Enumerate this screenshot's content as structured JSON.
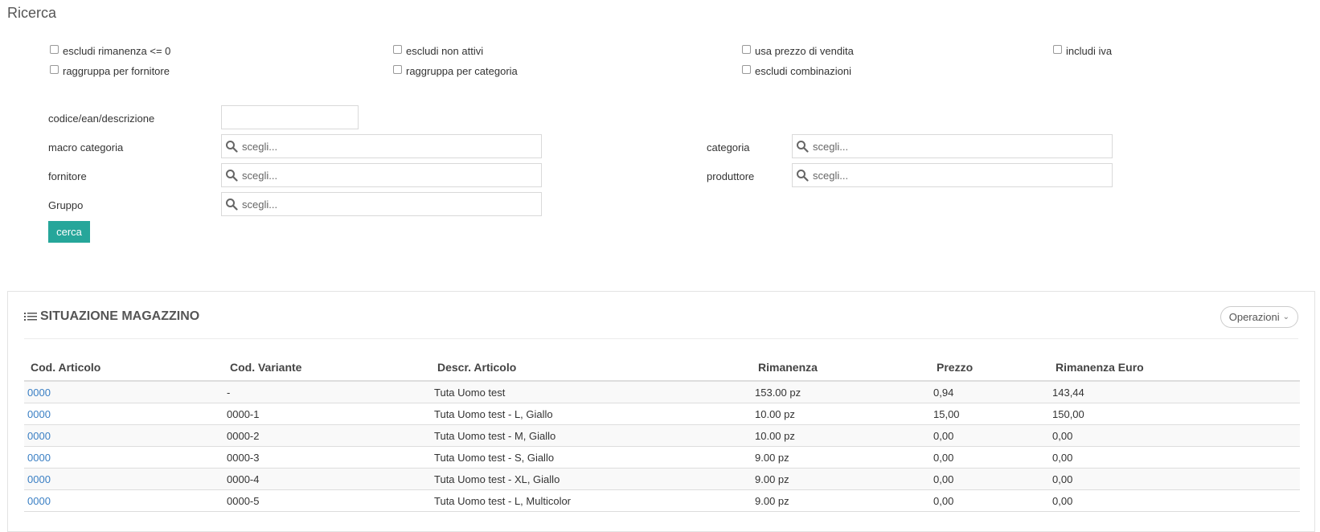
{
  "page_title": "Ricerca",
  "checkboxes": [
    {
      "label": "escludi rimanenza <= 0",
      "checked": false
    },
    {
      "label": "escludi non attivi",
      "checked": false
    },
    {
      "label": "usa prezzo di vendita",
      "checked": false
    },
    {
      "label": "includi iva",
      "checked": false
    },
    {
      "label": "raggruppa per fornitore",
      "checked": false
    },
    {
      "label": "raggruppa per categoria",
      "checked": false
    },
    {
      "label": "escludi combinazioni",
      "checked": false
    }
  ],
  "filters": {
    "code": {
      "label": "codice/ean/descrizione",
      "value": ""
    },
    "macro": {
      "label": "macro categoria",
      "placeholder": "scegli..."
    },
    "categoria": {
      "label": "categoria",
      "placeholder": "scegli..."
    },
    "fornitore": {
      "label": "fornitore",
      "placeholder": "scegli..."
    },
    "produttore": {
      "label": "produttore",
      "placeholder": "scegli..."
    },
    "gruppo": {
      "label": "Gruppo",
      "placeholder": "scegli..."
    }
  },
  "search_button": "cerca",
  "panel": {
    "title": "SITUAZIONE MAGAZZINO",
    "operations": "Operazioni",
    "columns": [
      "Cod. Articolo",
      "Cod. Variante",
      "Descr. Articolo",
      "Rimanenza",
      "Prezzo",
      "Rimanenza Euro"
    ],
    "rows": [
      [
        "0000",
        "-",
        "Tuta Uomo test",
        "153.00 pz",
        "0,94",
        "143,44"
      ],
      [
        "0000",
        "0000-1",
        "Tuta Uomo test - L, Giallo",
        "10.00 pz",
        "15,00",
        "150,00"
      ],
      [
        "0000",
        "0000-2",
        "Tuta Uomo test - M, Giallo",
        "10.00 pz",
        "0,00",
        "0,00"
      ],
      [
        "0000",
        "0000-3",
        "Tuta Uomo test - S, Giallo",
        "9.00 pz",
        "0,00",
        "0,00"
      ],
      [
        "0000",
        "0000-4",
        "Tuta Uomo test - XL, Giallo",
        "9.00 pz",
        "0,00",
        "0,00"
      ],
      [
        "0000",
        "0000-5",
        "Tuta Uomo test - L, Multicolor",
        "9.00 pz",
        "0,00",
        "0,00"
      ]
    ]
  },
  "colors": {
    "accent": "#26a69a",
    "link": "#3a7fc4"
  },
  "icons": {
    "search": "search-icon",
    "list": "list-icon",
    "chevron": "chevron-down-icon"
  }
}
